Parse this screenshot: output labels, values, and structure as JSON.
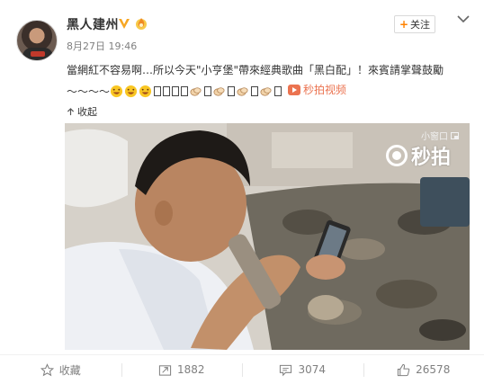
{
  "user": {
    "name": "黑人建州",
    "timestamp": "8月27日 19:46"
  },
  "header": {
    "follow_label": "关注"
  },
  "post": {
    "line1": "當網紅不容易啊…所以今天\"小亨堡\"帶來經典歌曲「黑白配」！來賓請掌聲鼓勵",
    "line2_prefix": "〜〜〜〜",
    "video_link_label": "秒拍视频"
  },
  "collapse_label": "收起",
  "video": {
    "mini_window_label": "小窗口",
    "brand_label": "秒拍"
  },
  "actions": [
    {
      "label": "收藏",
      "icon": "star-icon"
    },
    {
      "label": "1882",
      "icon": "share-icon"
    },
    {
      "label": "3074",
      "icon": "comment-icon"
    },
    {
      "label": "26578",
      "icon": "like-icon"
    }
  ],
  "colors": {
    "accent": "#ff8200",
    "link": "#eb7350",
    "muted": "#808080"
  }
}
